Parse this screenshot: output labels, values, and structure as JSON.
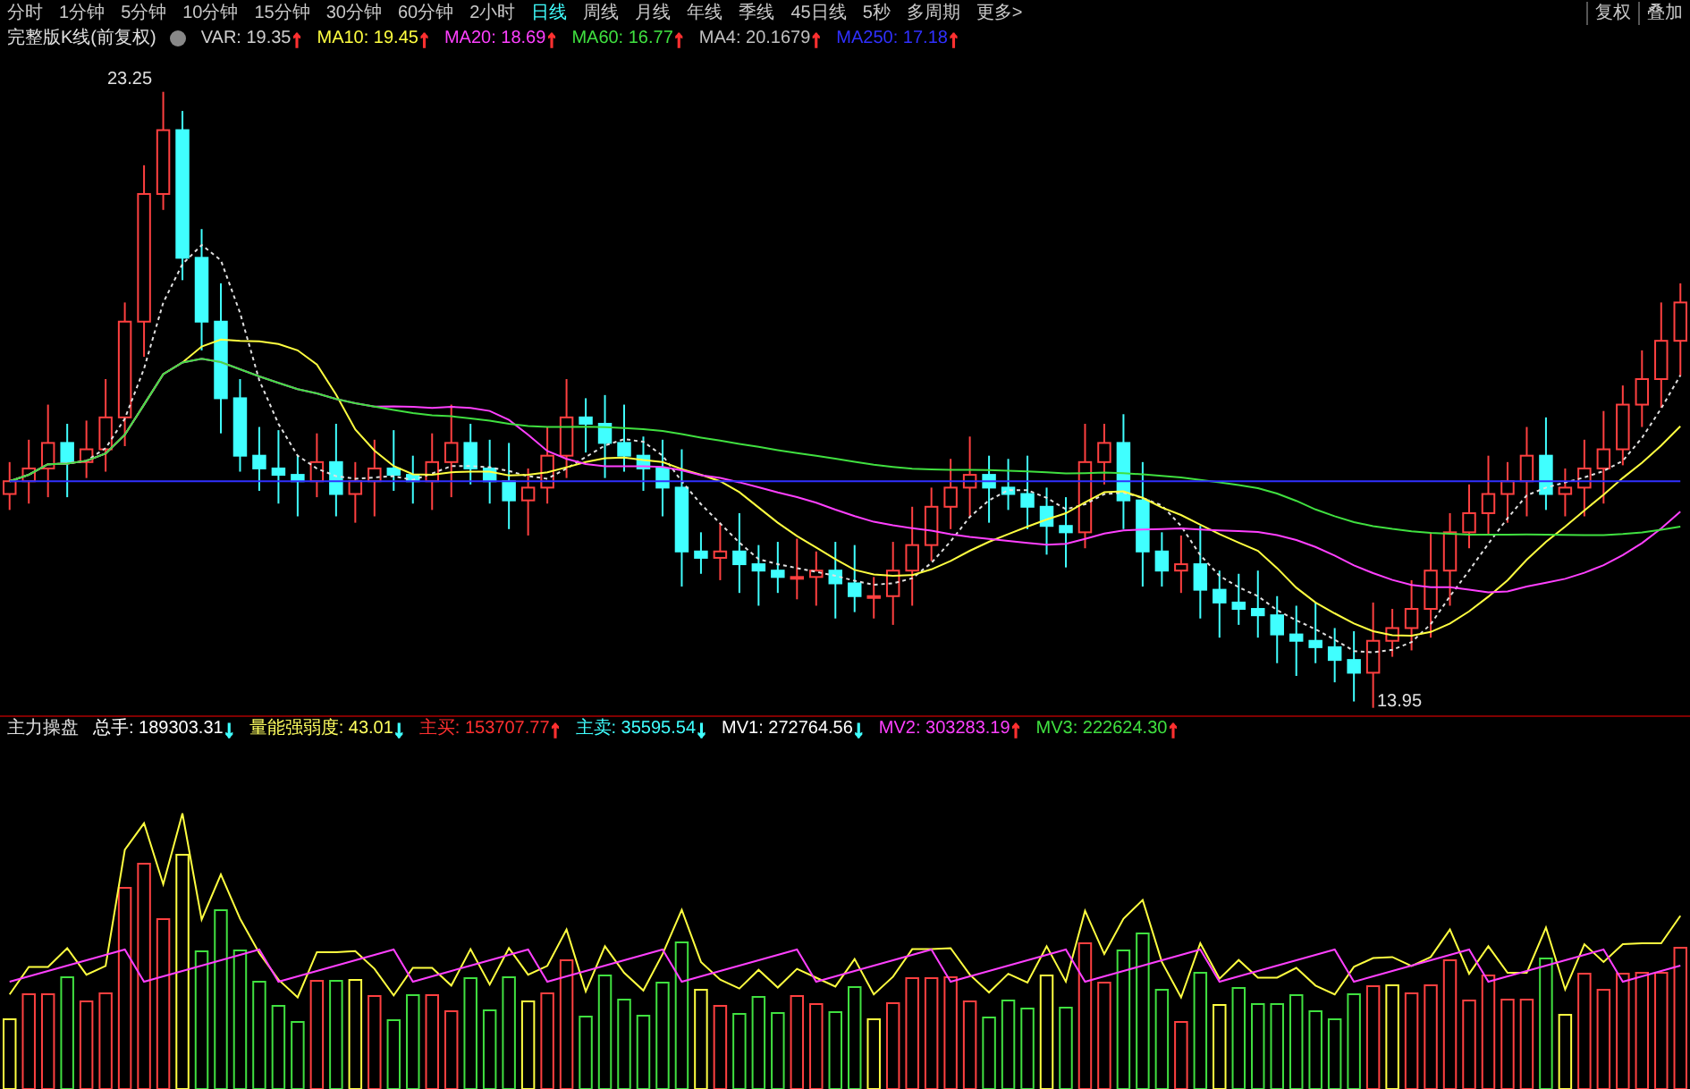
{
  "period_tabs": [
    {
      "label": "分时",
      "selected": false
    },
    {
      "label": "1分钟",
      "selected": false
    },
    {
      "label": "5分钟",
      "selected": false
    },
    {
      "label": "10分钟",
      "selected": false
    },
    {
      "label": "15分钟",
      "selected": false
    },
    {
      "label": "30分钟",
      "selected": false
    },
    {
      "label": "60分钟",
      "selected": false
    },
    {
      "label": "2小时",
      "selected": false
    },
    {
      "label": "日线",
      "selected": true
    },
    {
      "label": "周线",
      "selected": false
    },
    {
      "label": "月线",
      "selected": false
    },
    {
      "label": "年线",
      "selected": false
    },
    {
      "label": "季线",
      "selected": false
    },
    {
      "label": "45日线",
      "selected": false
    },
    {
      "label": "5秒",
      "selected": false
    },
    {
      "label": "多周期",
      "selected": false
    },
    {
      "label": "更多>",
      "selected": false
    }
  ],
  "right_tabs": [
    {
      "label": "复权"
    },
    {
      "label": "叠加"
    }
  ],
  "legend": {
    "title": "完整版K线(前复权)",
    "items": [
      {
        "text": "VAR: 19.35",
        "color": "#d0d0d0",
        "arrow": {
          "text": "↑",
          "color": "#ff3030"
        }
      },
      {
        "text": "MA10: 19.45",
        "color": "#ffff40",
        "arrow": {
          "text": "↑",
          "color": "#ff3030"
        }
      },
      {
        "text": "MA20: 18.69",
        "color": "#ff40ff",
        "arrow": {
          "text": "↑",
          "color": "#ff3030"
        }
      },
      {
        "text": "MA60: 16.77",
        "color": "#40e040",
        "arrow": {
          "text": "↑",
          "color": "#ff3030"
        }
      },
      {
        "text": "MA4: 20.1679",
        "color": "#c0c0c0",
        "arrow": {
          "text": "↑",
          "color": "#ff3030"
        }
      },
      {
        "text": "MA250: 17.18",
        "color": "#3030ff",
        "arrow": {
          "text": "↑",
          "color": "#ff3030"
        }
      }
    ]
  },
  "price_labels": {
    "high": "23.25",
    "low": "13.95"
  },
  "indicator": {
    "title": "主力操盘",
    "items": [
      {
        "text": "总手: 189303.31",
        "color": "#ffffff",
        "arrow": {
          "text": "↓",
          "color": "#40ffff"
        }
      },
      {
        "text": "量能强弱度: 43.01",
        "color": "#ffff60",
        "arrow": {
          "text": "↓",
          "color": "#40ffff"
        }
      },
      {
        "text": "主买: 153707.77",
        "color": "#ff3030",
        "arrow": {
          "text": "↑",
          "color": "#ff3030"
        }
      },
      {
        "text": "主卖: 35595.54",
        "color": "#40ffff",
        "arrow": {
          "text": "↓",
          "color": "#40ffff"
        }
      },
      {
        "text": "MV1: 272764.56",
        "color": "#ffffff",
        "arrow": {
          "text": "↓",
          "color": "#40ffff"
        }
      },
      {
        "text": "MV2: 303283.19",
        "color": "#ff40ff",
        "arrow": {
          "text": "↑",
          "color": "#ff3030"
        }
      },
      {
        "text": "MV3: 222624.30",
        "color": "#40e040",
        "arrow": {
          "text": "↑",
          "color": "#ff3030"
        }
      }
    ]
  }
}
